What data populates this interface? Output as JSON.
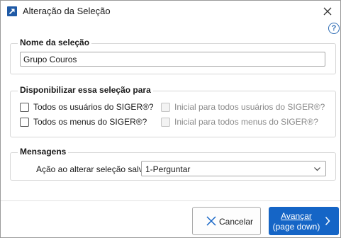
{
  "window": {
    "title": "Alteração da Seleção",
    "close_symbol": "✕",
    "help_symbol": "?"
  },
  "selection_name": {
    "legend": "Nome da seleção",
    "value": "Grupo Couros"
  },
  "availability": {
    "legend": "Disponibilizar essa seleção para",
    "options": [
      {
        "label": "Todos os usuários do SIGER®?",
        "checked": false,
        "enabled": true
      },
      {
        "label": "Todos os menus do SIGER®?",
        "checked": false,
        "enabled": true
      },
      {
        "label": "Inicial para todos usuários do SIGER®?",
        "checked": false,
        "enabled": false
      },
      {
        "label": "Inicial para todos menus do SIGER®?",
        "checked": false,
        "enabled": false
      }
    ]
  },
  "messages": {
    "legend": "Mensagens",
    "action_label": "Ação ao alterar seleção salva",
    "action_value": "1-Perguntar"
  },
  "footer": {
    "cancel_label": "Cancelar",
    "next_label_line1": "Avançar",
    "next_label_line2": "(page down)"
  },
  "icons": {
    "app": "arrow-up-right-icon",
    "close": "close-icon",
    "help": "help-icon",
    "dropdown": "chevron-down-icon",
    "cancel": "x-icon",
    "next": "chevron-right-icon"
  },
  "colors": {
    "primary_button": "#1565c6",
    "help_icon": "#2f6db5",
    "cancel_icon": "#1565c6"
  }
}
